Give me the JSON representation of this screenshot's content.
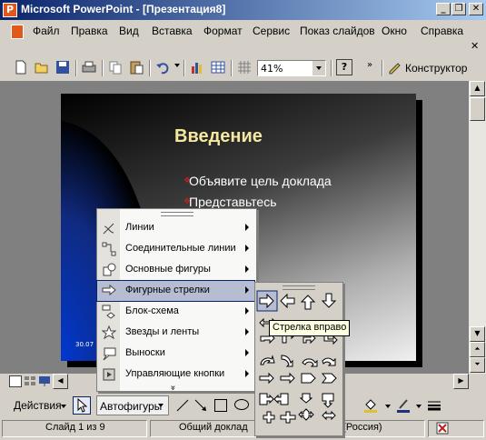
{
  "window": {
    "title": "Microsoft PowerPoint - [Презентация8]",
    "minimize": "_",
    "restore": "❐",
    "close": "✕"
  },
  "menu": [
    "Файл",
    "Правка",
    "Вид",
    "Вставка",
    "Формат",
    "Сервис",
    "Показ слайдов",
    "Окно",
    "Справка"
  ],
  "toolbar": {
    "zoom": "41%",
    "designer": "Конструктор",
    "help": "?"
  },
  "slide": {
    "title": "Введение",
    "bullets": [
      "Объявите цель доклада",
      "Представьтесь"
    ],
    "date": "30.07"
  },
  "autoshapes_menu": {
    "items": [
      {
        "label": "Линии",
        "icon": "lines-icon"
      },
      {
        "label": "Соединительные линии",
        "icon": "connectors-icon"
      },
      {
        "label": "Основные фигуры",
        "icon": "basic-shapes-icon"
      },
      {
        "label": "Фигурные стрелки",
        "icon": "block-arrows-icon"
      },
      {
        "label": "Блок-схема",
        "icon": "flowchart-icon"
      },
      {
        "label": "Звезды и ленты",
        "icon": "stars-banners-icon"
      },
      {
        "label": "Выноски",
        "icon": "callouts-icon"
      },
      {
        "label": "Управляющие кнопки",
        "icon": "action-buttons-icon"
      }
    ],
    "more": "»"
  },
  "arrows_palette": {
    "tooltip": "Стрелка вправо"
  },
  "draw_toolbar": {
    "actions": "Действия",
    "autoshapes": "Автофигуры"
  },
  "status": {
    "slide": "Слайд 1 из 9",
    "design": "Общий доклад",
    "language": "й (Россия)"
  }
}
